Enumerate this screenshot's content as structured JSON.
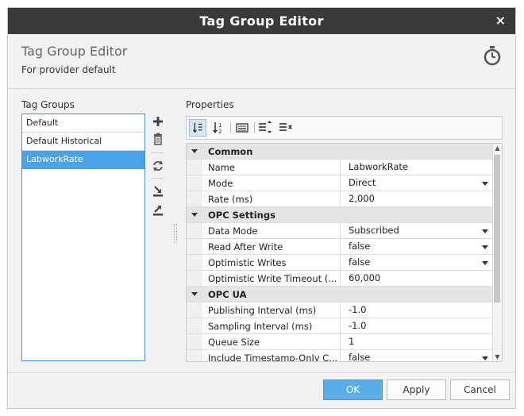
{
  "window": {
    "title": "Tag Group Editor",
    "close_glyph": "×"
  },
  "header": {
    "title": "Tag Group Editor",
    "subtitle": "For provider default",
    "icon": "clock-icon"
  },
  "tag_groups": {
    "label": "Tag Groups",
    "items": [
      {
        "label": "Default",
        "selected": false
      },
      {
        "label": "Default Historical",
        "selected": false
      },
      {
        "label": "LabworkRate",
        "selected": true
      }
    ],
    "buttons": [
      "add-icon",
      "delete-icon",
      "refresh-icon",
      "import-icon",
      "export-icon"
    ]
  },
  "properties": {
    "label": "Properties",
    "toolbar": [
      "sort-category-icon",
      "sort-alpha-icon",
      "property-pages-icon",
      "expand-all-icon",
      "collapse-all-icon"
    ],
    "rows": [
      {
        "type": "category",
        "name": "Common"
      },
      {
        "type": "prop",
        "name": "Name",
        "value": "LabworkRate",
        "dropdown": false
      },
      {
        "type": "prop",
        "name": "Mode",
        "value": "Direct",
        "dropdown": true
      },
      {
        "type": "prop",
        "name": "Rate (ms)",
        "value": "2,000",
        "dropdown": false
      },
      {
        "type": "category",
        "name": "OPC Settings"
      },
      {
        "type": "prop",
        "name": "Data Mode",
        "value": "Subscribed",
        "dropdown": true
      },
      {
        "type": "prop",
        "name": "Read After Write",
        "value": "false",
        "dropdown": true
      },
      {
        "type": "prop",
        "name": "Optimistic Writes",
        "value": "false",
        "dropdown": true
      },
      {
        "type": "prop",
        "name": "Optimistic Write Timeout (...",
        "value": "60,000",
        "dropdown": false
      },
      {
        "type": "category",
        "name": "OPC UA"
      },
      {
        "type": "prop",
        "name": "Publishing Interval (ms)",
        "value": "-1.0",
        "dropdown": false
      },
      {
        "type": "prop",
        "name": "Sampling Interval (ms)",
        "value": "-1.0",
        "dropdown": false
      },
      {
        "type": "prop",
        "name": "Queue Size",
        "value": "1",
        "dropdown": false
      },
      {
        "type": "prop",
        "name": "Include Timestamp-Only C...",
        "value": "false",
        "dropdown": true
      }
    ]
  },
  "footer": {
    "ok_label": "OK",
    "apply_label": "Apply",
    "cancel_label": "Cancel"
  },
  "colors": {
    "titlebar": "#3a3a3a",
    "selection": "#4aa3e6",
    "primary_button": "#5aaee8"
  }
}
